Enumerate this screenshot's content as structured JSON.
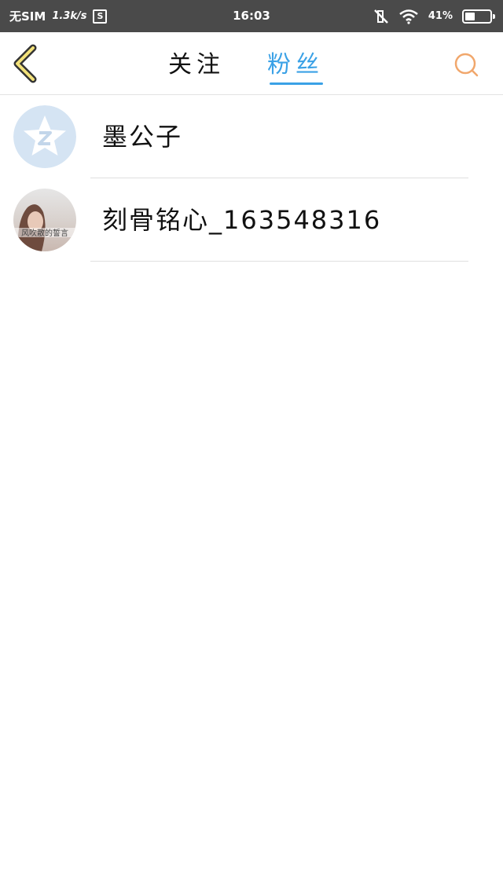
{
  "status_bar": {
    "sim": "无SIM",
    "net_speed": "1.3k/s",
    "sim_icon_label": "S",
    "time": "16:03",
    "battery_text": "41%",
    "battery_level": 0.41,
    "icons": [
      "sim-card-icon",
      "mute-icon",
      "wifi-icon",
      "battery-icon"
    ]
  },
  "nav": {
    "tabs": [
      {
        "label": "关注",
        "active": false
      },
      {
        "label": "粉丝",
        "active": true
      }
    ],
    "accent_color": "#3aa1e6",
    "back_icon": "chevron-left-icon",
    "search_icon": "search-icon"
  },
  "fans": [
    {
      "name": "墨公子",
      "avatar": "default-qq-avatar"
    },
    {
      "name": "刻骨铭心_163548316",
      "avatar": "photo-avatar",
      "avatar_text": "风吹散的誓言"
    }
  ]
}
